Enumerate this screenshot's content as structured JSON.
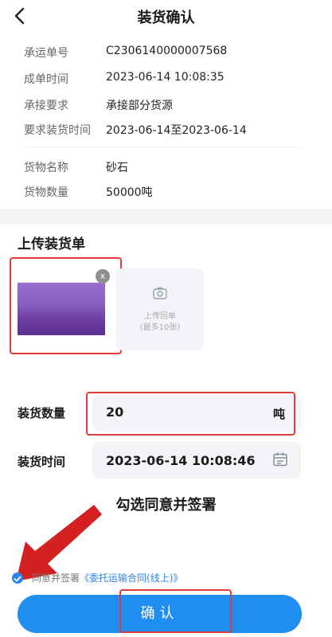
{
  "header": {
    "title": "装货确认"
  },
  "info": [
    {
      "label": "承运单号",
      "value": "C2306140000007568"
    },
    {
      "label": "成单时间",
      "value": "2023-06-14 10:08:35"
    },
    {
      "label": "承接要求",
      "value": "承接部分货源"
    },
    {
      "label": "要求装货时间",
      "value": "2023-06-14至2023-06-14"
    }
  ],
  "cargo": [
    {
      "label": "货物名称",
      "value": "砂石"
    },
    {
      "label": "货物数量",
      "value": "50000吨"
    }
  ],
  "upload": {
    "title": "上传装货单",
    "close_label": "x",
    "button_label": "上传回单",
    "button_hint": "(最多10张)"
  },
  "form": {
    "quantity_label": "装货数量",
    "quantity_value": "20",
    "quantity_unit": "吨",
    "time_label": "装货时间",
    "time_value": "2023-06-14 10:08:46"
  },
  "annotation": {
    "hint": "勾选同意并签署"
  },
  "agreement": {
    "prefix": "同意并签署",
    "link": "《委托运输合同(线上)》"
  },
  "confirm": {
    "label": "确认"
  },
  "colors": {
    "accent": "#1e8ff0",
    "highlight": "#e23a3a"
  }
}
